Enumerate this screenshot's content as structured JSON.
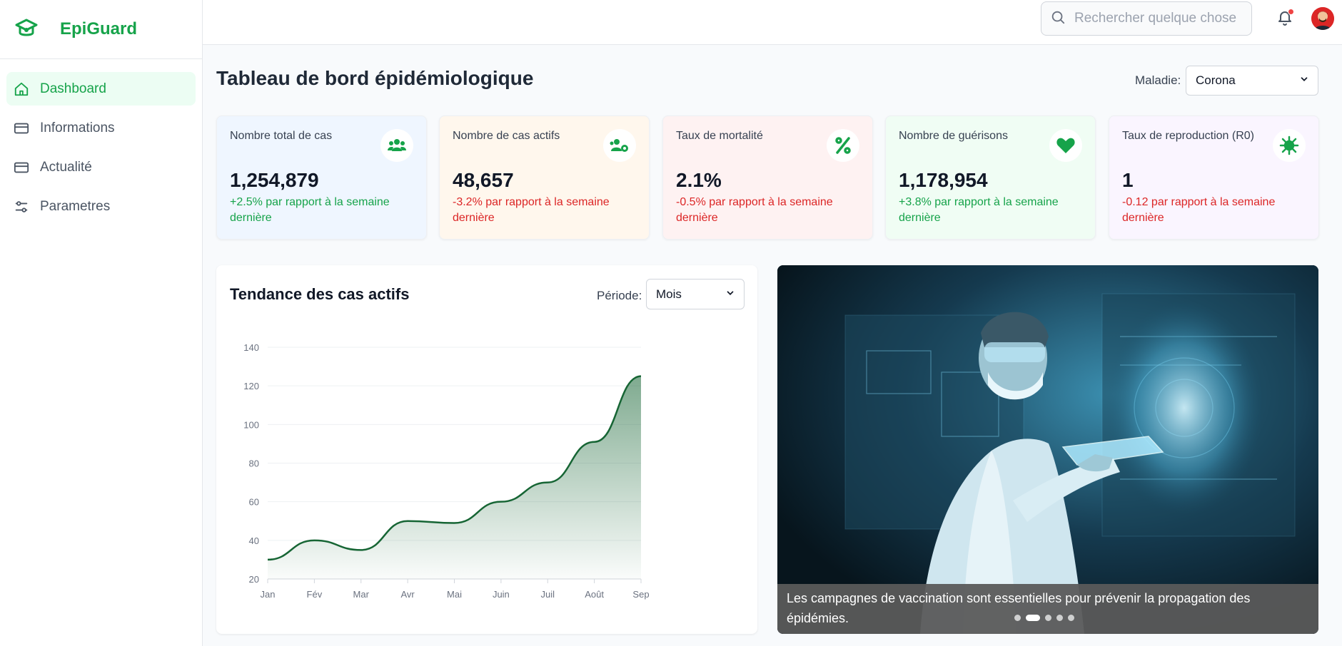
{
  "app": {
    "name": "EpiGuard"
  },
  "sidebar": {
    "items": [
      {
        "label": "Dashboard",
        "icon": "home-icon",
        "active": true
      },
      {
        "label": "Informations",
        "icon": "card-icon",
        "active": false
      },
      {
        "label": "Actualité",
        "icon": "card-icon",
        "active": false
      },
      {
        "label": "Parametres",
        "icon": "sliders-icon",
        "active": false
      }
    ]
  },
  "header": {
    "search_placeholder": "Rechercher quelque chose",
    "has_notification": true
  },
  "page": {
    "title": "Tableau de bord épidémiologique",
    "disease_label": "Maladie:",
    "disease_value": "Corona"
  },
  "colors": {
    "accent": "#16a34a",
    "negative": "#dc2626",
    "line": "#166534"
  },
  "cards": [
    {
      "label": "Nombre total de cas",
      "value": "1,254,879",
      "delta": "+2.5% par rapport à la semaine dernière",
      "trend": "pos",
      "bg": "#eff6ff",
      "icon": "users-icon"
    },
    {
      "label": "Nombre de cas actifs",
      "value": "48,657",
      "delta": "-3.2% par rapport à la semaine dernière",
      "trend": "neg",
      "bg": "#fff7ed",
      "icon": "users-gear-icon"
    },
    {
      "label": "Taux de mortalité",
      "value": "2.1%",
      "delta": "-0.5% par rapport à la semaine dernière",
      "trend": "neg",
      "bg": "#fef2f2",
      "icon": "percent-icon"
    },
    {
      "label": "Nombre de guérisons",
      "value": "1,178,954",
      "delta": "+3.8% par rapport à la semaine dernière",
      "trend": "pos",
      "bg": "#f0fdf4",
      "icon": "heart-icon"
    },
    {
      "label": "Taux de reproduction (R0)",
      "value": "1",
      "delta": "-0.12 par rapport à la semaine dernière",
      "trend": "neg",
      "bg": "#faf5ff",
      "icon": "virus-icon"
    }
  ],
  "chart_panel": {
    "title": "Tendance des cas actifs",
    "period_label": "Période:",
    "period_value": "Mois"
  },
  "chart_data": {
    "type": "area",
    "title": "Tendance des cas actifs",
    "categories": [
      "Jan",
      "Fév",
      "Mar",
      "Avr",
      "Mai",
      "Juin",
      "Juil",
      "Août",
      "Sep"
    ],
    "series": [
      {
        "values": [
          30,
          40,
          35,
          50,
          49,
          60,
          70,
          91,
          125
        ]
      }
    ],
    "xlabel": "",
    "ylabel": "",
    "ylim": [
      20,
      140
    ],
    "yticks": [
      20,
      40,
      60,
      80,
      100,
      120,
      140
    ],
    "grid": true,
    "legend": "none"
  },
  "carousel": {
    "caption": "Les campagnes de vaccination sont essentielles pour prévenir la propagation des épidémies.",
    "slide_count": 5,
    "active_index": 1
  }
}
